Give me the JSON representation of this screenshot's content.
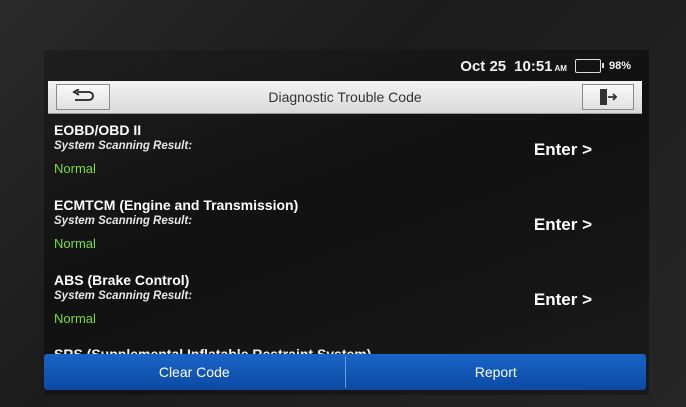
{
  "status_bar": {
    "date": "Oct 25",
    "time": "10:51",
    "ampm": "AM",
    "battery_percent": "98%",
    "battery_level": 0.98,
    "battery_color": "#39d339"
  },
  "header": {
    "title": "Diagnostic Trouble Code",
    "back_icon": "return-arrow-icon",
    "exit_icon": "exit-door-icon"
  },
  "systems": [
    {
      "name": "EOBD/OBD II",
      "label": "System Scanning Result:",
      "result": "Normal",
      "action": "Enter >"
    },
    {
      "name": "ECMTCM (Engine and Transmission)",
      "label": "System Scanning Result:",
      "result": "Normal",
      "action": "Enter >"
    },
    {
      "name": "ABS (Brake Control)",
      "label": "System Scanning Result:",
      "result": "Normal",
      "action": "Enter >"
    },
    {
      "name": "SRS (Supplemental Inflatable Restraint System)"
    }
  ],
  "bottom_bar": {
    "clear_code": "Clear Code",
    "report": "Report"
  },
  "colors": {
    "result_ok": "#7ddc3c",
    "bottom_bar": "#1a64c7"
  }
}
